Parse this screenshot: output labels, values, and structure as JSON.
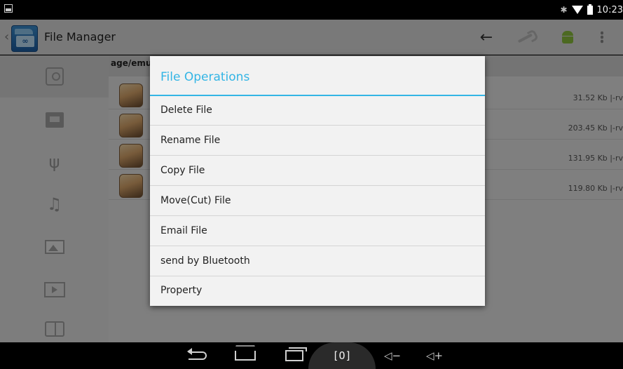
{
  "status_bar": {
    "time": "10:23",
    "bluetooth_icon": "bluetooth-icon",
    "wifi_icon": "wifi-icon",
    "battery_icon": "battery-icon"
  },
  "action_bar": {
    "title": "File Manager",
    "icons": [
      "arrow-back-icon",
      "wrench-icon",
      "android-icon",
      "overflow-menu-icon"
    ]
  },
  "sidebar": {
    "items": [
      "disk-icon",
      "sd-card-icon",
      "usb-icon",
      "music-icon",
      "image-icon",
      "video-icon",
      "book-icon"
    ],
    "selected_index": 0
  },
  "path": "age/emul",
  "files": [
    {
      "meta": "31.52 Kb |-rv"
    },
    {
      "meta": "203.45 Kb |-rv"
    },
    {
      "meta": "131.95 Kb |-rv"
    },
    {
      "meta": "119.80 Kb |-rv"
    }
  ],
  "dialog": {
    "title": "File Operations",
    "accent_color": "#33b5e5",
    "items": [
      "Delete File",
      "Rename File",
      "Copy File",
      "Move(Cut) File",
      "Email File",
      "send by Bluetooth",
      "Property"
    ]
  },
  "nav_bar": {
    "screenshot_label": "[O]",
    "volume_down_label": "◁−",
    "volume_up_label": "◁+"
  }
}
